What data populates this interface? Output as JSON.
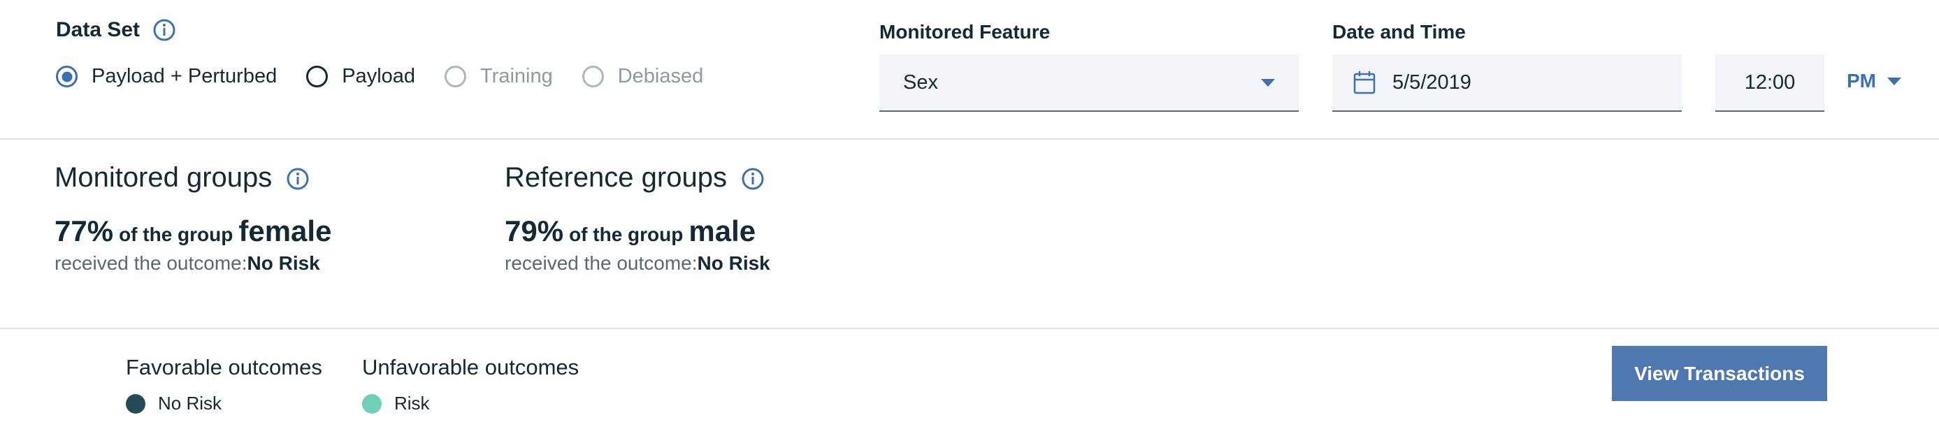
{
  "dataset": {
    "title": "Data Set",
    "options": [
      {
        "label": "Payload + Perturbed",
        "state": "checked"
      },
      {
        "label": "Payload",
        "state": "enabled"
      },
      {
        "label": "Training",
        "state": "disabled"
      },
      {
        "label": "Debiased",
        "state": "disabled"
      }
    ]
  },
  "monitored_feature": {
    "label": "Monitored Feature",
    "value": "Sex"
  },
  "date_time": {
    "label": "Date and Time",
    "date": "5/5/2019",
    "time": "12:00",
    "ampm": "PM"
  },
  "monitored_groups": {
    "title": "Monitored groups",
    "percent": "77%",
    "of_group": "of the group",
    "group": "female",
    "outcome_prefix": "received the outcome:",
    "outcome": "No Risk"
  },
  "reference_groups": {
    "title": "Reference groups",
    "percent": "79%",
    "of_group": "of the group",
    "group": "male",
    "outcome_prefix": "received the outcome:",
    "outcome": "No Risk"
  },
  "legend": {
    "favorable": {
      "title": "Favorable outcomes",
      "item": "No Risk",
      "color": "#264a57"
    },
    "unfavorable": {
      "title": "Unfavorable outcomes",
      "item": "Risk",
      "color": "#6fd0b8"
    }
  },
  "actions": {
    "view_transactions": "View Transactions"
  },
  "colors": {
    "accent": "#3d70b2",
    "button": "#4f77b0"
  }
}
